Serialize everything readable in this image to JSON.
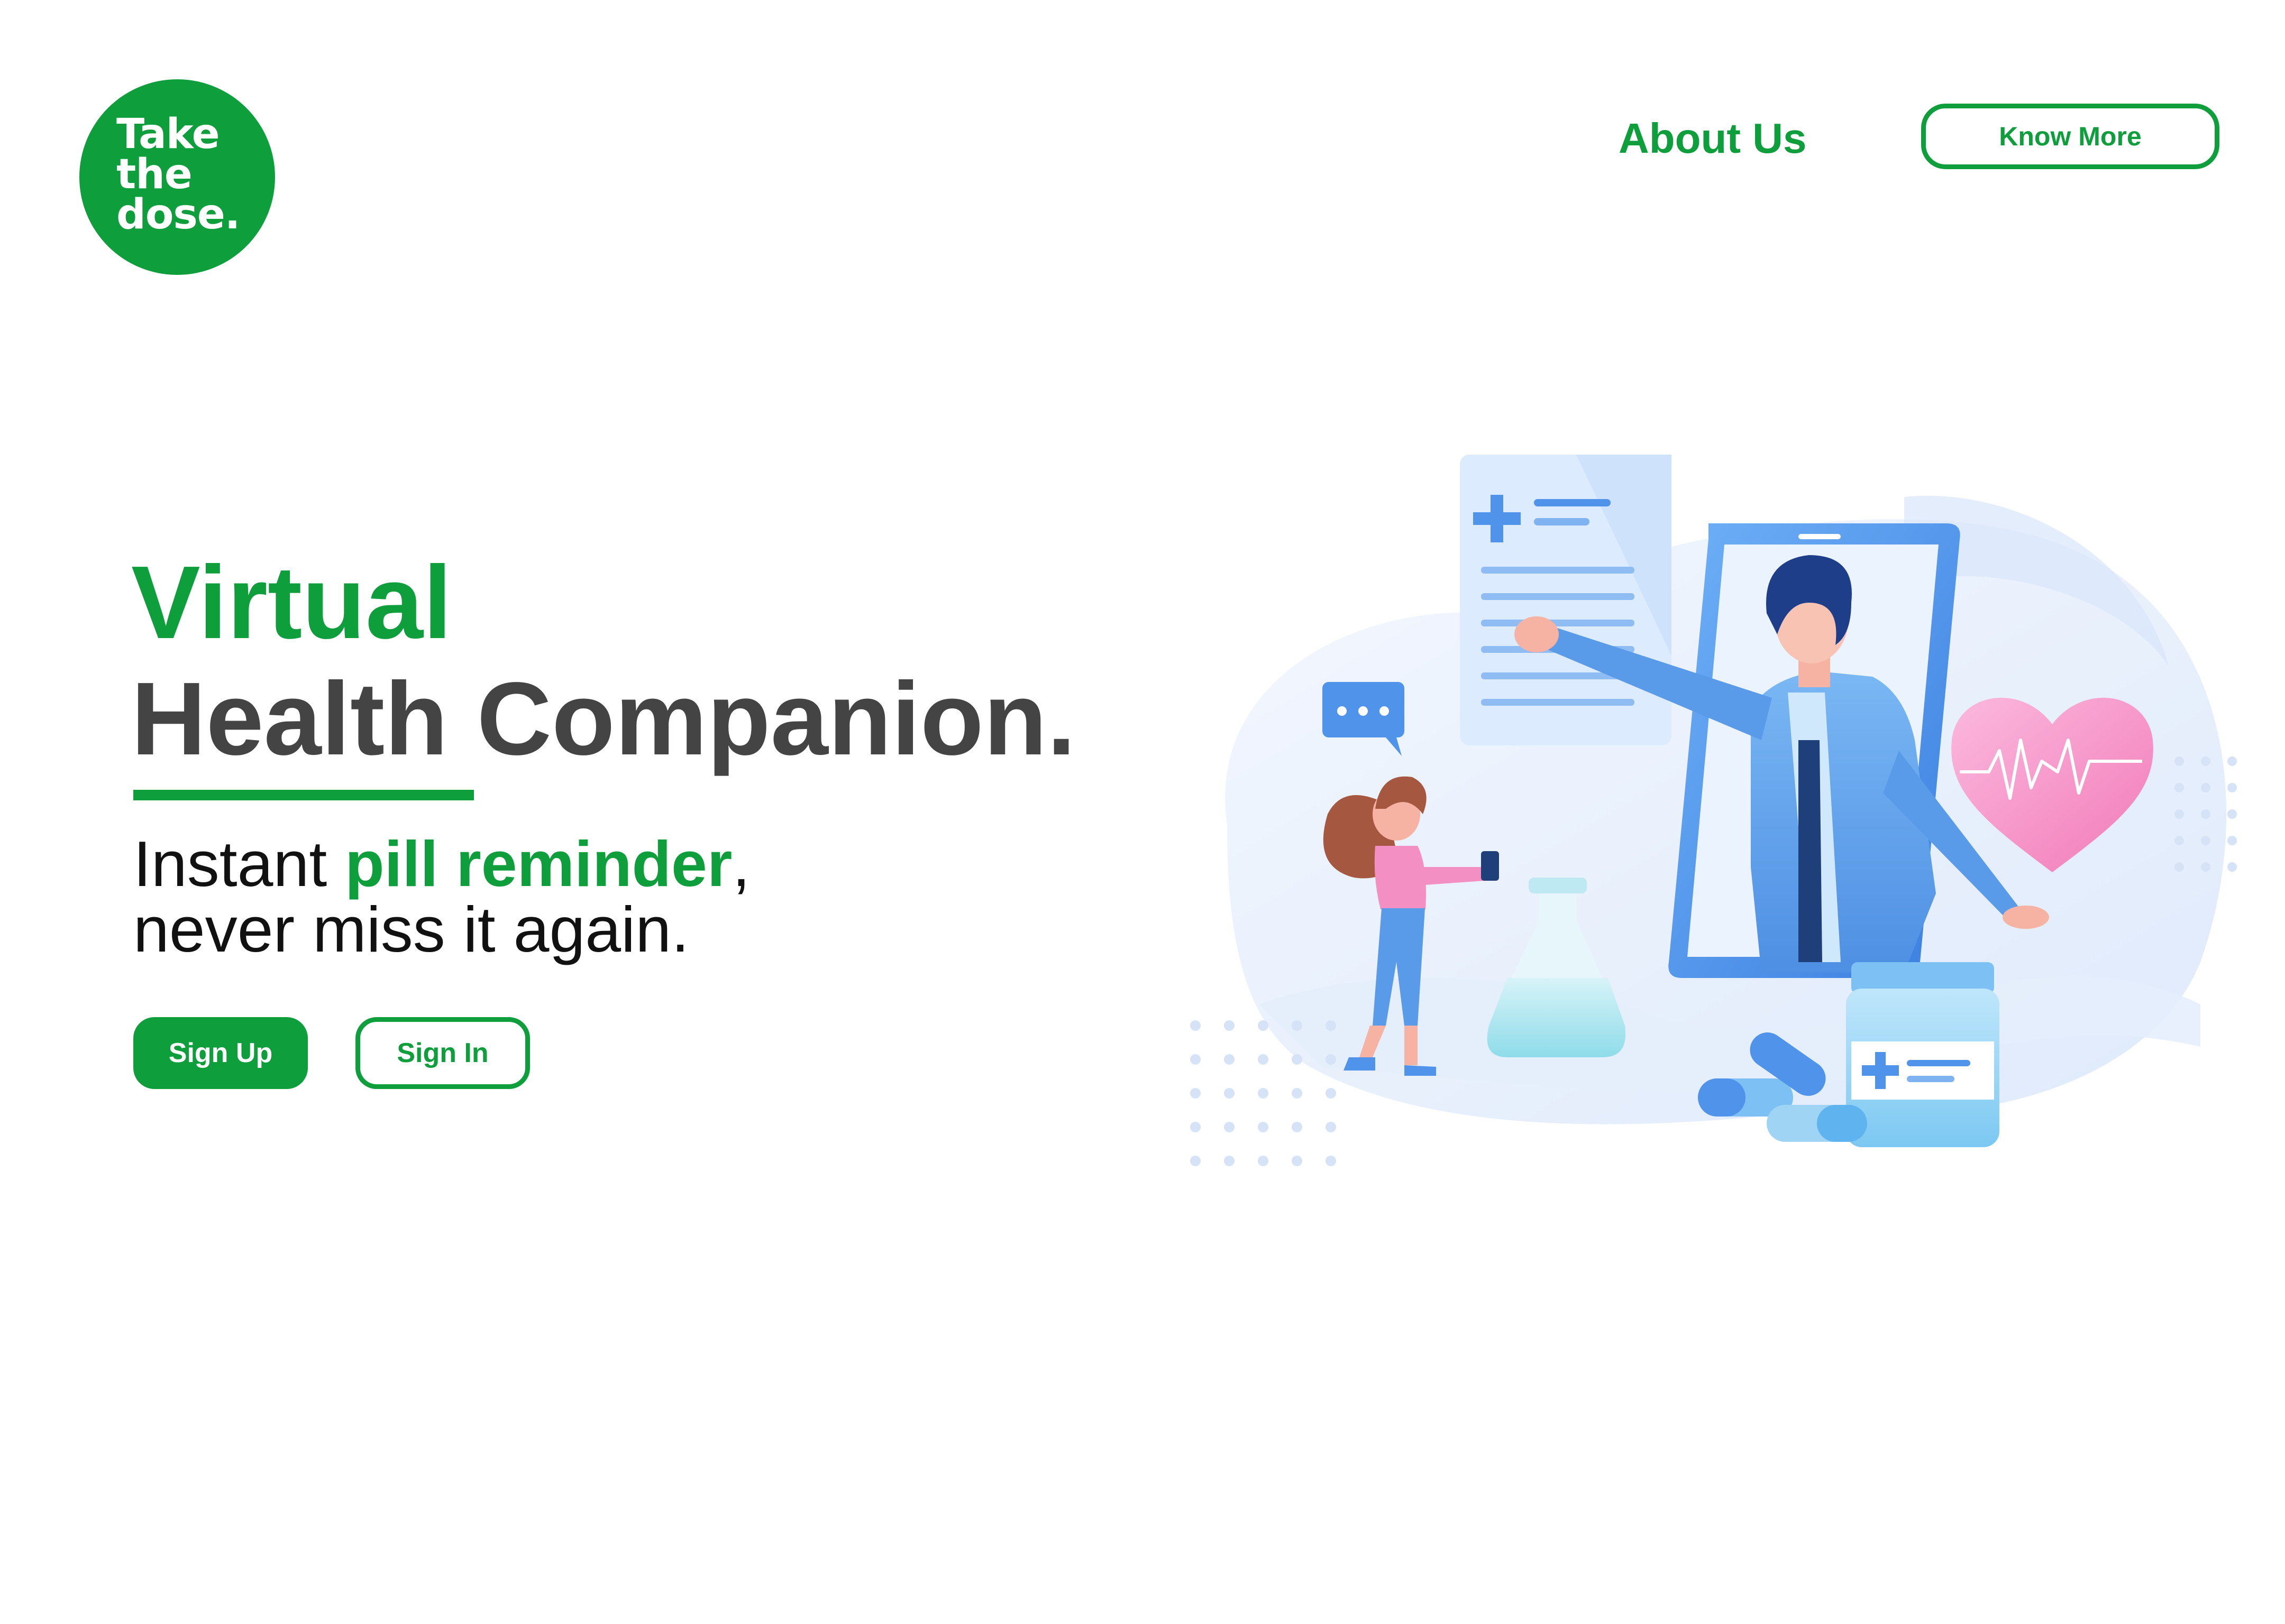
{
  "brand": {
    "logo_lines": [
      "Take",
      "the",
      "dose."
    ],
    "color": "#0e9e3b"
  },
  "nav": {
    "about_label": "About Us",
    "know_more_label": "Know More"
  },
  "hero": {
    "headline_line1": "Virtual",
    "headline_line2": "Health Companion.",
    "tagline_prefix": "Instant ",
    "tagline_highlight": "pill reminder",
    "tagline_suffix": ",",
    "tagline_line2": "never miss it again.",
    "sign_up_label": "Sign Up",
    "sign_in_label": "Sign In"
  },
  "illustration": {
    "icons": [
      "medical-report-icon",
      "smartphone-icon",
      "doctor-figure",
      "heart-pulse-icon",
      "chat-bubble-icon",
      "woman-with-phone-figure",
      "flask-icon",
      "medicine-bottle-icon",
      "pill-capsule-icon"
    ],
    "colors": {
      "blob": "#eaf2fd",
      "blue": "#5b9ef0",
      "dark_blue": "#1f4fa8",
      "pink": "#f48fc4",
      "light_blue": "#9fd4f5"
    }
  }
}
